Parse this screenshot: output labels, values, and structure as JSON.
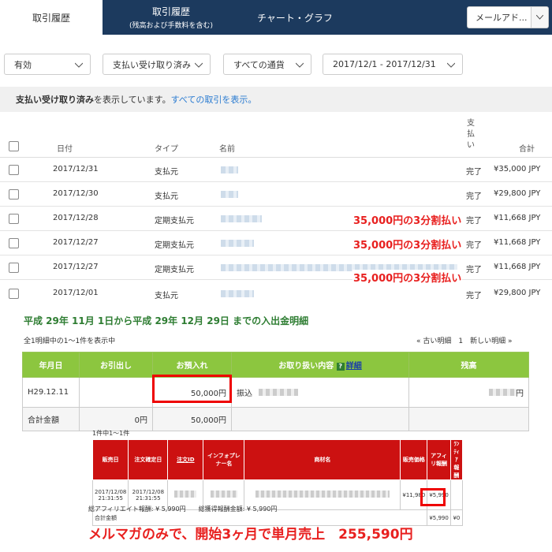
{
  "tabs": [
    {
      "label": "取引履歴",
      "sub": ""
    },
    {
      "label": "取引履歴",
      "sub": "(残高および手数料を含む)"
    },
    {
      "label": "チャート・グラフ",
      "sub": ""
    }
  ],
  "email_select": "メールアド...",
  "filters": [
    "有効",
    "支払い受け取り済み",
    "すべての通貨",
    "2017/12/1 - 2017/12/31"
  ],
  "info": {
    "bold": "支払い受け取り済み",
    "text": "を表示しています。",
    "link": "すべての取引を表示。"
  },
  "table_headers": {
    "date": "日付",
    "type": "タイプ",
    "name": "名前",
    "status": "支払い",
    "total": "合計"
  },
  "transactions": [
    {
      "date": "2017/12/31",
      "type": "支払元",
      "status": "完了",
      "total": "¥35,000 JPY"
    },
    {
      "date": "2017/12/30",
      "type": "支払元",
      "status": "完了",
      "total": "¥29,800 JPY"
    },
    {
      "date": "2017/12/28",
      "type": "定期支払元",
      "status": "完了",
      "total": "¥11,668 JPY"
    },
    {
      "date": "2017/12/27",
      "type": "定期支払元",
      "status": "完了",
      "total": "¥11,668 JPY"
    },
    {
      "date": "2017/12/27",
      "type": "定期支払元",
      "status": "完了",
      "total": "¥11,668 JPY"
    },
    {
      "date": "2017/12/01",
      "type": "支払元",
      "status": "完了",
      "total": "¥29,800 JPY"
    }
  ],
  "annotation": "35,000円の3分割払い",
  "bank": {
    "title": "平成 29年 11月 1日から平成 29年 12月 29日 までの入出金明細",
    "count": "全1明細中の1～1件を表示中",
    "nav": "« 古い明細　1　新しい明細 »",
    "headers": [
      "年月日",
      "お引出し",
      "お預入れ",
      "お取り扱い内容",
      "残高"
    ],
    "detail_link": "詳細",
    "row": {
      "date": "H29.12.11",
      "withdraw": "",
      "deposit": "50,000円",
      "desc": "振込",
      "balance": "円"
    },
    "total": {
      "label": "合計金額",
      "withdraw": "0円",
      "deposit": "50,000円"
    }
  },
  "affiliate": {
    "caption": "1件中1～1件",
    "headers": [
      "販売日",
      "注文確定日",
      "注文ID",
      "インフォプレナー名",
      "商材名",
      "販売価格",
      "アフィリ報酬",
      "ﾗﾝﾃｨｱ報酬"
    ],
    "row": {
      "sale_date": "2017/12/08 21:31:55",
      "confirm_date": "2017/12/08 21:31:55",
      "price": "¥11,980",
      "reward": "¥5,990"
    },
    "total_label": "合計金額",
    "total_reward": "¥5,990",
    "total_other": "¥0",
    "footer": "総アフィリエイト報酬: ¥ 5,990円　　総獲得報酬金額: ¥ 5,990円"
  },
  "summary": "メルマガのみで、開始3ヶ月で単月売上　255,590円"
}
